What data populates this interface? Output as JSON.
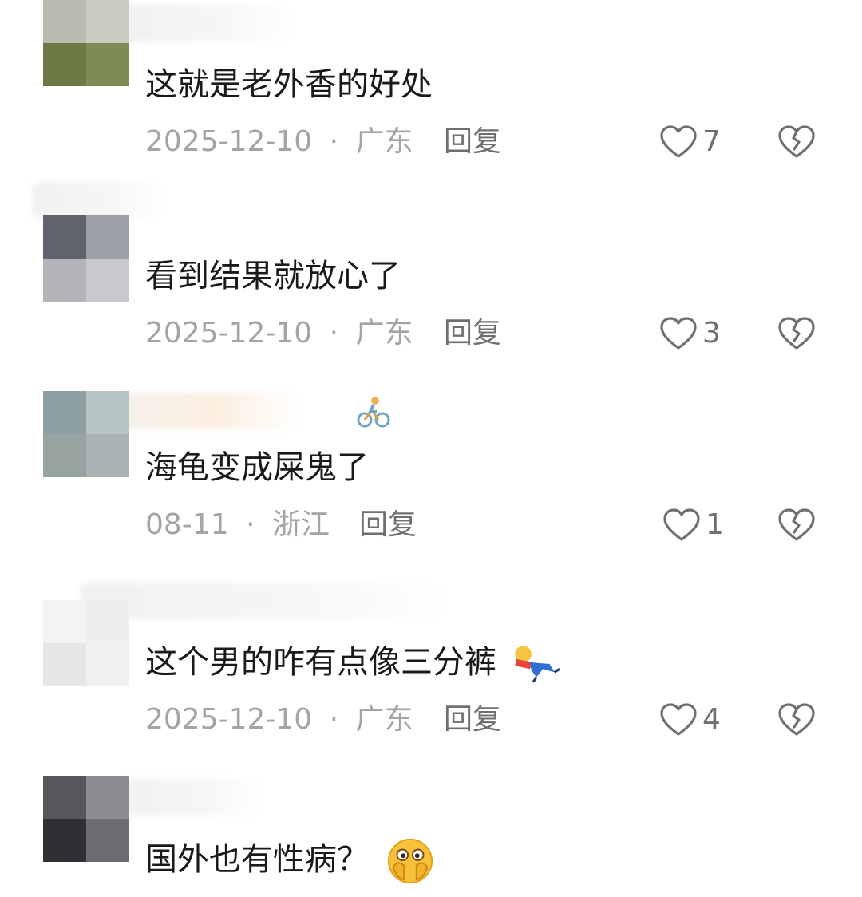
{
  "comments": [
    {
      "text": "这就是老外香的好处",
      "date": "2025-12-10",
      "separator": "·",
      "location": "广东",
      "reply_label": "回复",
      "likes": "7",
      "avatar_colors": [
        "#9aa380",
        "#c9cdc0",
        "#6d7a45",
        "#7f8b55"
      ]
    },
    {
      "text": "看到结果就放心了",
      "date": "2025-12-10",
      "separator": "·",
      "location": "广东",
      "reply_label": "回复",
      "likes": "3",
      "avatar_colors": [
        "#5f636b",
        "#9b9ea6",
        "#b3b5bb",
        "#c8c9cd"
      ]
    },
    {
      "text": "海龟变成屎鬼了",
      "date": "08-11",
      "separator": "·",
      "location": "浙江",
      "reply_label": "回复",
      "likes": "1",
      "avatar_colors": [
        "#8e9fa2",
        "#b5c3c4",
        "#97a3a1",
        "#a9b3b3"
      ]
    },
    {
      "text": "这个男的咋有点像三分裤",
      "date": "2025-12-10",
      "separator": "·",
      "location": "广东",
      "reply_label": "回复",
      "likes": "4",
      "avatar_colors": [
        "#f3f3f3",
        "#eeeeee",
        "#e6e6e6",
        "#f0f0f0"
      ]
    },
    {
      "text": "国外也有性病？",
      "avatar_colors": [
        "#55575b",
        "#8b8d92",
        "#2f3033",
        "#6b6d72"
      ]
    }
  ],
  "icons": {
    "like": "heart-outline-icon",
    "dislike": "broken-heart-icon"
  },
  "colors": {
    "text": "#1a1a1a",
    "meta": "#a4a4a4",
    "reply": "#6f6f6f",
    "icon": "#707070"
  }
}
